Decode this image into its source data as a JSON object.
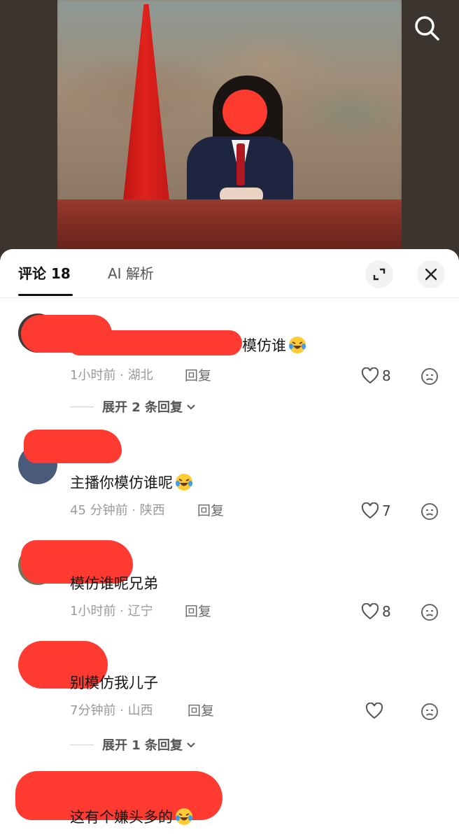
{
  "header": {
    "search_icon": "search-icon"
  },
  "tabs": {
    "comments_label": "评论 18",
    "ai_label": "AI 解析",
    "expand_icon": "expand-icon",
    "close_icon": "close-icon"
  },
  "comments": [
    {
      "text": "模仿谁",
      "emoji": "laughing-tears-emoji",
      "meta": "1小时前 · 湖北",
      "reply_label": "回复",
      "likes": "8",
      "expand_label": "展开 2 条回复"
    },
    {
      "text": "主播你模仿谁呢",
      "emoji": "laughing-tears-emoji",
      "meta": "45 分钟前 · 陕西",
      "reply_label": "回复",
      "likes": "7"
    },
    {
      "text": "模仿谁呢兄弟",
      "meta": "1小时前 · 辽宁",
      "reply_label": "回复",
      "likes": "8"
    },
    {
      "text": "别模仿我儿子",
      "meta": "7分钟前 · 山西",
      "reply_label": "回复",
      "likes": "",
      "expand_label": "展开 1 条回复"
    },
    {
      "text": "这有个嫌头多的",
      "emoji": "laughing-tears-emoji"
    }
  ],
  "colors": {
    "redaction": "#ff3a30",
    "meta": "#9a9a9a",
    "flag": "#e0221c"
  }
}
